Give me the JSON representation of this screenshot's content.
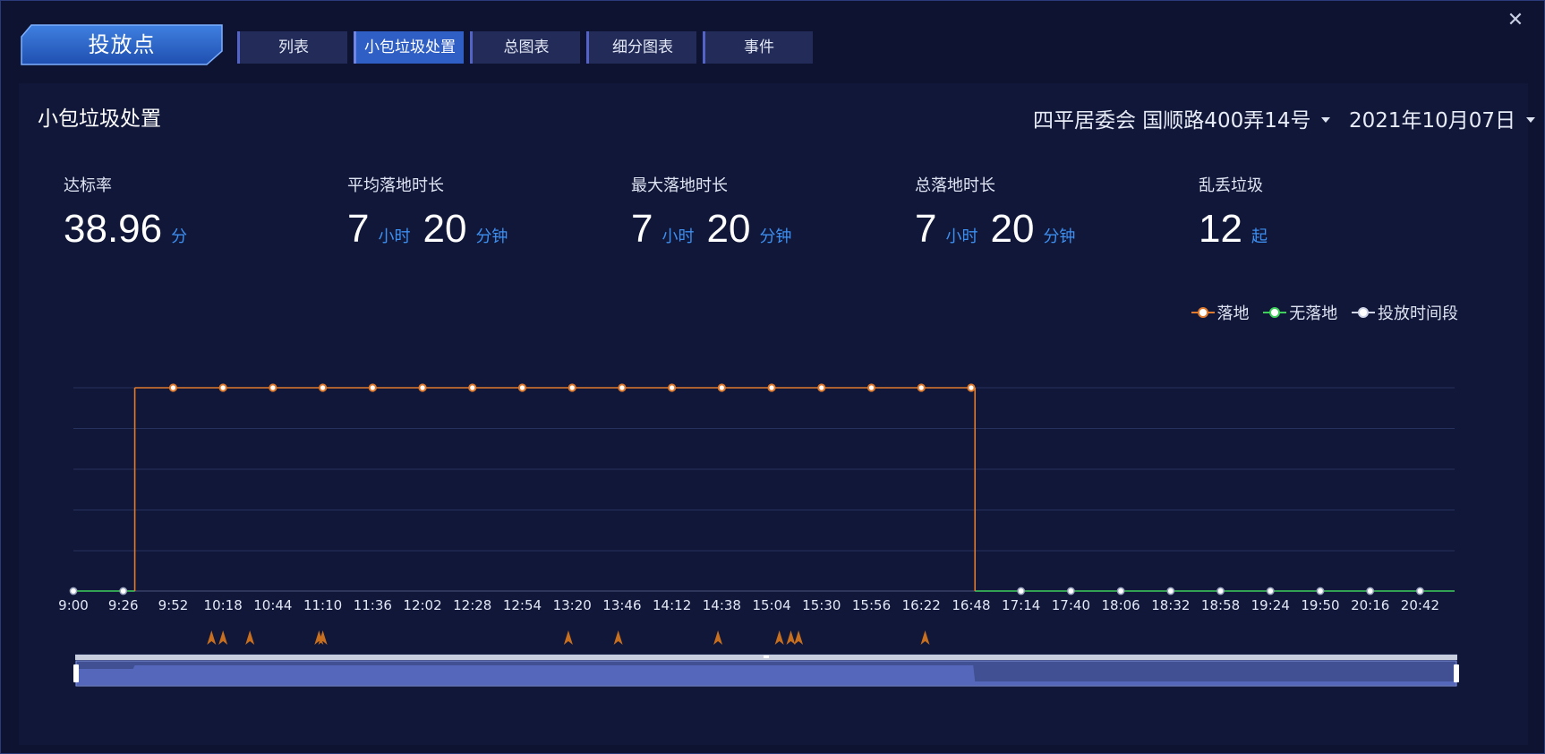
{
  "header": {
    "badge_title": "投放点",
    "tabs": [
      {
        "label": "列表",
        "active": false
      },
      {
        "label": "小包垃圾处置",
        "active": true
      },
      {
        "label": "总图表",
        "active": false
      },
      {
        "label": "细分图表",
        "active": false
      },
      {
        "label": "事件",
        "active": false
      }
    ],
    "close_icon": "close-icon"
  },
  "panel": {
    "title": "小包垃圾处置",
    "location_select": "四平居委会 国顺路400弄14号",
    "date_select": "2021年10月07日"
  },
  "stats": [
    {
      "label": "达标率",
      "parts": [
        {
          "num": "38.96",
          "unit": "分"
        }
      ]
    },
    {
      "label": "平均落地时长",
      "parts": [
        {
          "num": "7",
          "unit": "小时"
        },
        {
          "num": "20",
          "unit": "分钟"
        }
      ]
    },
    {
      "label": "最大落地时长",
      "parts": [
        {
          "num": "7",
          "unit": "小时"
        },
        {
          "num": "20",
          "unit": "分钟"
        }
      ]
    },
    {
      "label": "总落地时长",
      "parts": [
        {
          "num": "7",
          "unit": "小时"
        },
        {
          "num": "20",
          "unit": "分钟"
        }
      ]
    },
    {
      "label": "乱丢垃圾",
      "parts": [
        {
          "num": "12",
          "unit": "起"
        }
      ]
    }
  ],
  "colors": {
    "accent": "#2f5fc4",
    "unit_blue": "#3d8ff0",
    "landed": "#e07b2e",
    "not_landed": "#3ecf5a",
    "drop_period": "#cfd5e6",
    "event_marker": "#c76f1f"
  },
  "chart_data": {
    "type": "line",
    "legend": [
      {
        "name": "落地",
        "color": "#e07b2e"
      },
      {
        "name": "无落地",
        "color": "#3ecf5a"
      },
      {
        "name": "投放时间段",
        "color": "#cfd5e6"
      }
    ],
    "legend_position": "top-right",
    "x_tick_labels": [
      "9:00",
      "9:26",
      "9:52",
      "10:18",
      "10:44",
      "11:10",
      "11:36",
      "12:02",
      "12:28",
      "12:54",
      "13:20",
      "13:46",
      "14:12",
      "14:38",
      "15:04",
      "15:30",
      "15:56",
      "16:22",
      "16:48",
      "17:14",
      "17:40",
      "18:06",
      "18:32",
      "18:58",
      "19:24",
      "19:50",
      "20:16",
      "20:42"
    ],
    "x_range": [
      "9:00",
      "21:00"
    ],
    "step_series": {
      "name": "落地",
      "segments": [
        {
          "from": "9:00",
          "to": "9:32",
          "state": "无落地"
        },
        {
          "from": "9:32",
          "to": "16:50",
          "state": "落地"
        },
        {
          "from": "16:50",
          "to": "21:00",
          "state": "无落地"
        }
      ]
    },
    "landed_points": [
      "9:52",
      "10:18",
      "10:44",
      "11:10",
      "11:36",
      "12:02",
      "12:28",
      "12:54",
      "13:20",
      "13:46",
      "14:12",
      "14:38",
      "15:04",
      "15:30",
      "15:56",
      "16:22",
      "16:48"
    ],
    "drop_period_points": [
      "9:00",
      "9:26",
      "17:14",
      "17:40",
      "18:06",
      "18:32",
      "18:58",
      "19:24",
      "19:50",
      "20:16",
      "20:42"
    ],
    "littering_events": [
      "10:12",
      "10:18",
      "10:32",
      "11:08",
      "11:10",
      "13:18",
      "13:44",
      "14:36",
      "15:08",
      "15:14",
      "15:18",
      "16:24"
    ],
    "y_grid_lines": 5,
    "grid": true,
    "zoom_window": [
      "9:32",
      "16:50"
    ]
  }
}
